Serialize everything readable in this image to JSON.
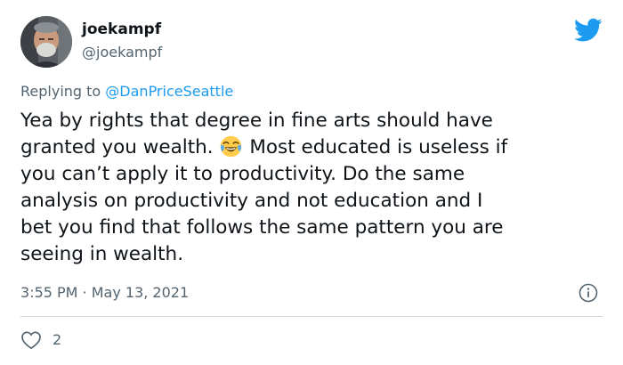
{
  "user": {
    "display_name": "joekampf",
    "handle": "@joekampf"
  },
  "reply": {
    "prefix": "Replying to ",
    "mention": "@DanPriceSeattle"
  },
  "tweet": {
    "line1": "Yea by rights that degree in fine arts should have",
    "line2_before": "granted you wealth.",
    "line2_after": "Most educated is useless if",
    "line3": "you can’t apply it to productivity. Do the same",
    "line4": "analysis on productivity and not education and I",
    "line5": "bet you find that follows the same pattern you are",
    "line6": "seeing in wealth.",
    "emoji": "face-with-tears-of-joy"
  },
  "meta": {
    "time": "3:55 PM",
    "separator": " · ",
    "date": "May 13, 2021"
  },
  "actions": {
    "like_count": "2"
  },
  "icons": {
    "logo": "twitter-bird-icon",
    "info": "info-icon",
    "like": "heart-icon"
  },
  "colors": {
    "twitter_blue": "#1d9bf0",
    "text_primary": "#0f1419",
    "text_secondary": "#536471",
    "divider": "#cfd9de"
  }
}
